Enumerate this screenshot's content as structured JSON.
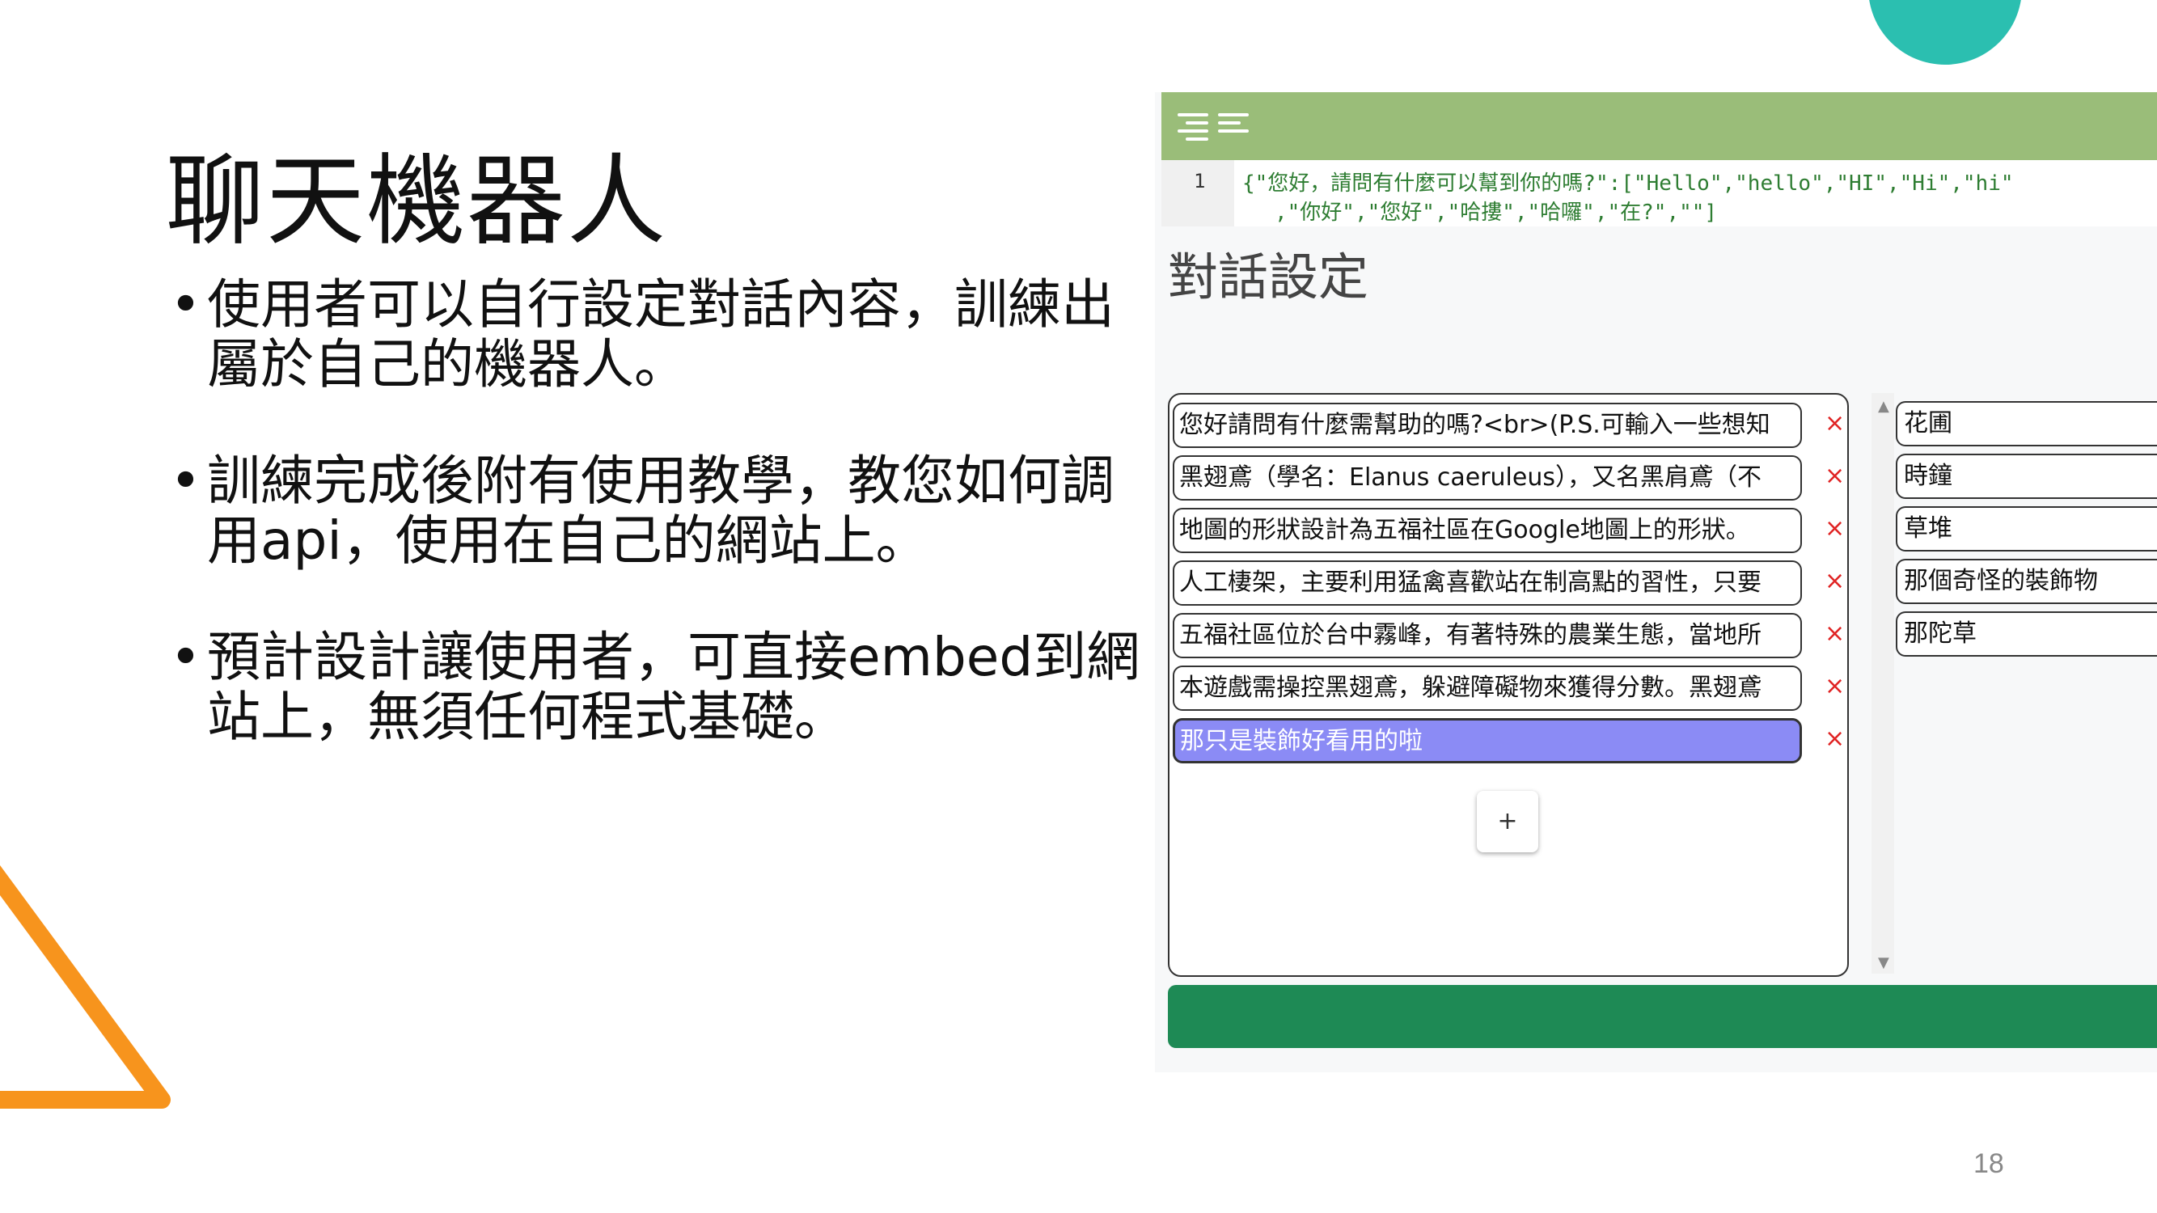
{
  "slide": {
    "title": "聊天機器人",
    "bullets": [
      "使用者可以自行設定對話內容，訓練出屬於自己的機器人。",
      "訓練完成後附有使用教學，教您如何調用api，使用在自己的網站上。",
      "預計設計讓使用者，可直接embed到網站上，無須任何程式基礎。"
    ],
    "page_number": "18"
  },
  "editor": {
    "line_number": "1",
    "code_line1": "{\"您好，請問有什麼可以幫到你的嗎?\":[\"Hello\",\"hello\",\"HI\",\"Hi\",\"hi\"",
    "code_line2": ",\"你好\",\"您好\",\"哈摟\",\"哈囉\",\"在?\",\"\"]"
  },
  "dialog_settings": {
    "title": "對話設定",
    "messages": [
      "您好請問有什麼需幫助的嗎?<br>(P.S.可輸入一些想知",
      "黑翅鳶（學名：Elanus caeruleus），又名黑肩鳶（不",
      "地圖的形狀設計為五福社區在Google地圖上的形狀。",
      "人工棲架，主要利用猛禽喜歡站在制高點的習性，只要",
      "五福社區位於台中霧峰，有著特殊的農業生態，當地所",
      "本遊戲需操控黑翅鳶，躲避障礙物來獲得分數。黑翅鳶",
      "那只是裝飾好看用的啦"
    ],
    "delete_symbol": "×",
    "add_label": "+",
    "keywords": [
      "花圃",
      "時鐘",
      "草堆",
      "那個奇怪的裝飾物",
      "那陀草"
    ]
  },
  "colors": {
    "toolbar": "#9abd79",
    "selected": "#8b8bf5",
    "save_bar": "#1e8a55",
    "delete": "#e02424",
    "teal": "#2bbfb0",
    "orange": "#f7941d"
  }
}
